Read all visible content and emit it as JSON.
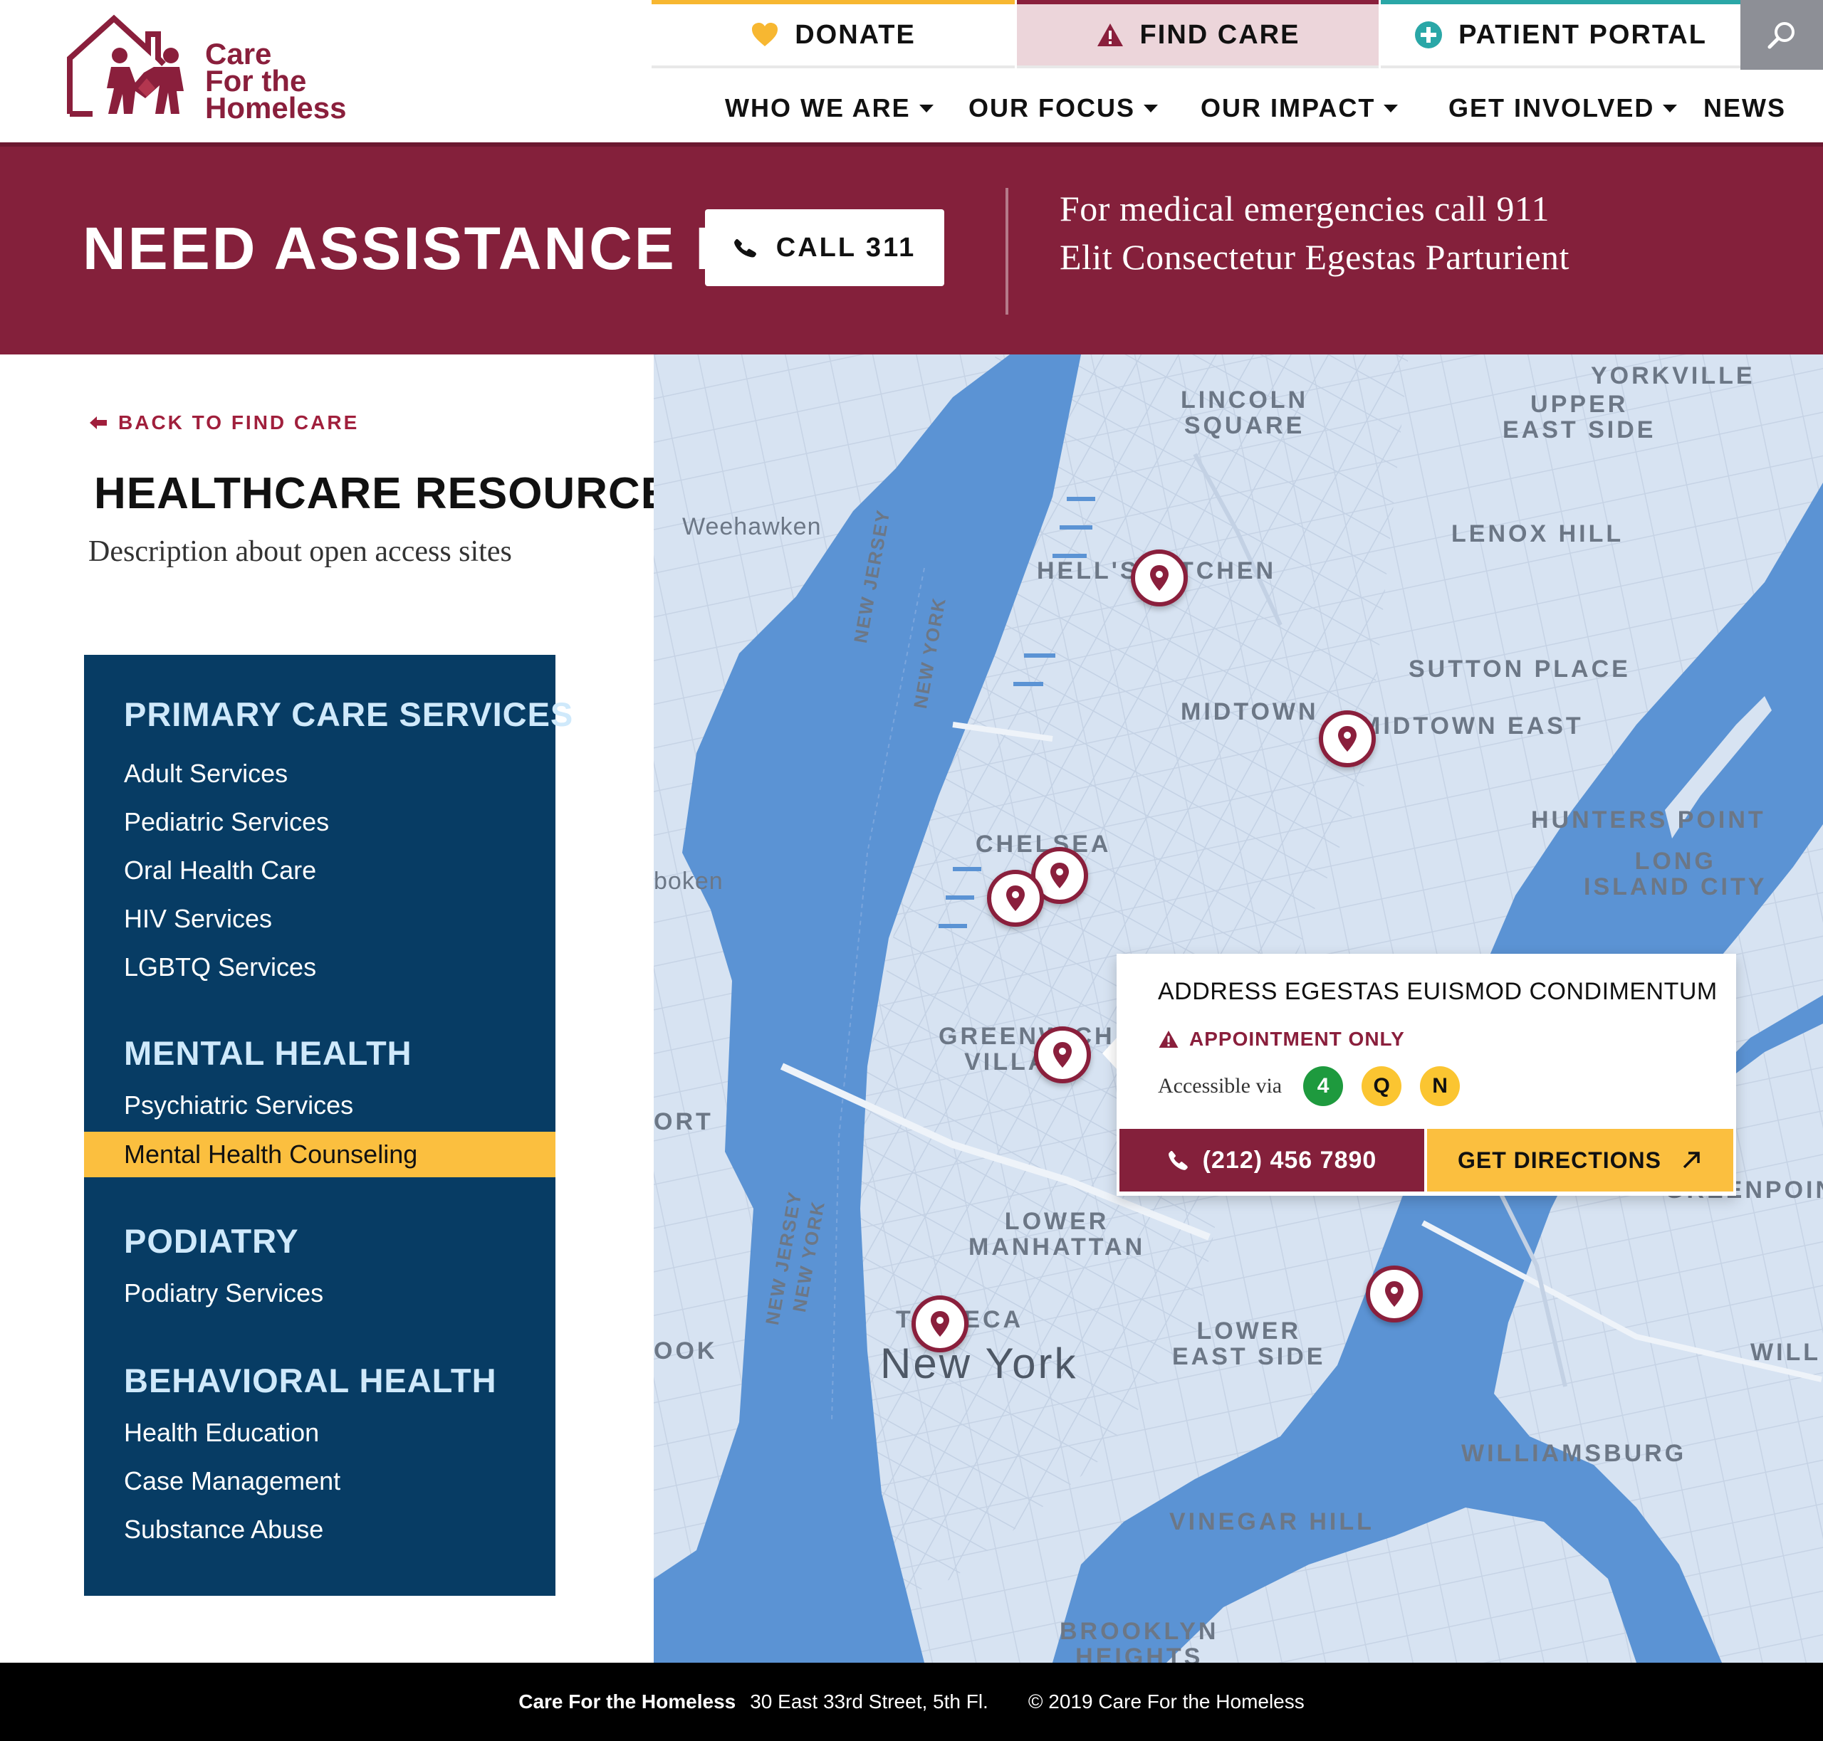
{
  "brand": {
    "logo_line1": "Care",
    "logo_line2": "For the",
    "logo_line3": "Homeless",
    "color_primary": "#84203b",
    "color_accent": "#fbbf3f",
    "color_navy": "#073c64"
  },
  "utility_nav": {
    "donate": "DONATE",
    "find_care": "FIND CARE",
    "patient_portal": "PATIENT PORTAL",
    "icons": [
      "heart-icon",
      "warning-icon",
      "plus-circle-icon",
      "search-icon"
    ]
  },
  "main_nav": [
    {
      "label": "WHO WE ARE",
      "dropdown": true
    },
    {
      "label": "OUR FOCUS",
      "dropdown": true
    },
    {
      "label": "OUR IMPACT",
      "dropdown": true
    },
    {
      "label": "GET INVOLVED",
      "dropdown": true
    },
    {
      "label": "NEWS",
      "dropdown": false
    }
  ],
  "banner": {
    "title": "NEED ASSISTANCE NOW?",
    "call_label": "CALL 311",
    "line1": "For medical emergencies call 911",
    "line2": "Elit Consectetur Egestas Parturient"
  },
  "sidebar": {
    "back_label": "BACK TO FIND CARE",
    "title": "HEALTHCARE RESOURCES",
    "description": "Description about open access sites",
    "groups": [
      {
        "heading": "PRIMARY CARE SERVICES",
        "items": [
          "Adult Services",
          "Pediatric Services",
          "Oral Health Care",
          "HIV Services",
          "LGBTQ Services"
        ]
      },
      {
        "heading": "MENTAL HEALTH",
        "items": [
          "Psychiatric Services",
          "Mental Health Counseling"
        ]
      },
      {
        "heading": "PODIATRY",
        "items": [
          "Podiatry Services"
        ]
      },
      {
        "heading": "BEHAVIORAL HEALTH",
        "items": [
          "Health Education",
          "Case Management",
          "Substance Abuse"
        ]
      }
    ],
    "active_item": "Mental Health Counseling"
  },
  "map": {
    "labels": {
      "lincoln_square": "LINCOLN\nSQUARE",
      "yorkville": "YORKVILLE",
      "upper_east_side": "UPPER\nEAST SIDE",
      "weehawken": "Weehawken",
      "lenox_hill": "LENOX HILL",
      "hells_kitchen": "HELL'S KITCHEN",
      "sutton_place": "SUTTON PLACE",
      "midtown": "MIDTOWN",
      "midtown_east": "MIDTOWN EAST",
      "hunters_point": "HUNTERS POINT",
      "long_island_city": "LONG\nISLAND CITY",
      "chelsea": "CHELSEA",
      "hoboken": "boken",
      "greenwich_village": "GREENWICH\nVILLAGE",
      "port": "ORT",
      "lower_manhattan": "LOWER\nMANHATTAN",
      "greenpoint": "GREENPOINT",
      "tribeca": "TRIBECA",
      "lower_east_side": "LOWER\nEAST SIDE",
      "ook": "OOK",
      "new_york": "New York",
      "will": "WILL",
      "williamsburg": "WILLIAMSBURG",
      "vinegar_hill": "VINEGAR HILL",
      "brooklyn_heights": "BROOKLYN\nHEIGHTS",
      "new_jersey": "NEW JERSEY",
      "new_york_state": "NEW YORK"
    },
    "popup": {
      "address": "ADDRESS EGESTAS EUISMOD CONDIMENTUM",
      "badge": "APPOINTMENT ONLY",
      "accessible_label": "Accessible via",
      "trains": [
        {
          "line": "4",
          "color": "#1e9a3e"
        },
        {
          "line": "Q",
          "color": "#fbc531"
        },
        {
          "line": "N",
          "color": "#fbc531"
        }
      ],
      "phone": "(212) 456 7890",
      "directions": "GET DIRECTIONS"
    }
  },
  "footer": {
    "org": "Care For the Homeless",
    "address": "30 East 33rd Street, 5th Fl.",
    "copyright": "© 2019 Care For the Homeless"
  }
}
